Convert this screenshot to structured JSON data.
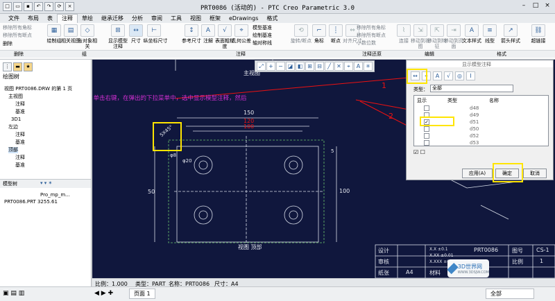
{
  "window": {
    "title": "PRT0086 (活动的) - PTC Creo Parametric 3.0"
  },
  "tabs": [
    "文件",
    "布局",
    "表",
    "注释",
    "草绘",
    "继承迁移",
    "分析",
    "审阅",
    "工具",
    "视图",
    "框架",
    "eDrawings",
    "格式"
  ],
  "active_tab": "注释",
  "ribbon": {
    "delete_group": [
      "移除所有角标",
      "移除所有断点",
      "删除"
    ],
    "buttons": [
      "绘制组",
      "相关视图",
      "与对象相关",
      "显示模型注释",
      "尺寸",
      "纵坐标尺寸",
      "参考尺寸",
      "注解",
      "表面粗糙度",
      "几何公差",
      "旋转/断点",
      "角标",
      "断点",
      "对齐尺寸",
      "清除尺寸",
      "连接",
      "移动到视图",
      "移动到特征",
      "移动到页面",
      "文本样式",
      "线型",
      "箭头样式",
      "超链接"
    ],
    "small_items": [
      "模型基准",
      "绘制基准",
      "轴对称线",
      "移除所有角标",
      "移除所有断点",
      "小数位数"
    ],
    "groups": [
      "删除",
      "组",
      "注释",
      "注释还原",
      "编辑",
      "格式"
    ]
  },
  "left_panel": {
    "title": "绘图树",
    "root": "视图 PRT0086.DRW 的第 1 页",
    "tree": [
      "主视图",
      "注释",
      "基准",
      "3D1",
      "左边",
      "注释",
      "基准",
      "顶部",
      "注释",
      "基准"
    ],
    "model_tree_title": "模型树",
    "col_header": "Pro_mp_m...",
    "part_row": "PRT0086.PRT  3255.61"
  },
  "drawing": {
    "view_labels": [
      "主视图",
      "视图 顶部"
    ],
    "dims": [
      "150",
      "120",
      "100",
      "100",
      "50",
      "5X45°",
      "φ8",
      "φ20",
      "5"
    ],
    "title_block": {
      "design": "设计",
      "check": "审核",
      "sheet": "纸张",
      "paper": "A4",
      "name": "PRT0086",
      "drawing_no": "图号",
      "scale": "比例",
      "scale_val": "1",
      "code": "CS-1",
      "material": "材料",
      "tolerance": "公差",
      "tol_x": "X.X  ±0.1",
      "tol_xx": "X.XX ±0.01",
      "tol_xxx": "X.XXX ±0.001"
    },
    "annotation": "选中顶部视图，单击右键，在弹出的下拉菜单中，选中显示模型注释，然后",
    "callouts": [
      "1",
      "2",
      "3"
    ]
  },
  "status": {
    "scale": "比例：1.000",
    "type": "类型：PART",
    "name": "名称：PRT0086",
    "sheet_size": "尺寸：A4"
  },
  "bottom": {
    "page_tab": "页面 1",
    "filter": "全部"
  },
  "dialog": {
    "title": "显示模型注释",
    "type_label": "类型：",
    "type_value": "全部",
    "col_show": "显示",
    "col_type": "类型",
    "col_name": "名称",
    "rows": [
      {
        "name": "d48",
        "checked": false
      },
      {
        "name": "d49",
        "checked": false
      },
      {
        "name": "d51",
        "checked": true
      },
      {
        "name": "d50",
        "checked": false
      },
      {
        "name": "d52",
        "checked": false
      },
      {
        "name": "d53",
        "checked": false
      }
    ],
    "apply": "应用(A)",
    "ok": "确定",
    "cancel": "取消"
  },
  "watermark": {
    "brand": "3D世界网",
    "url": "WWW.3DSJW.COM"
  }
}
